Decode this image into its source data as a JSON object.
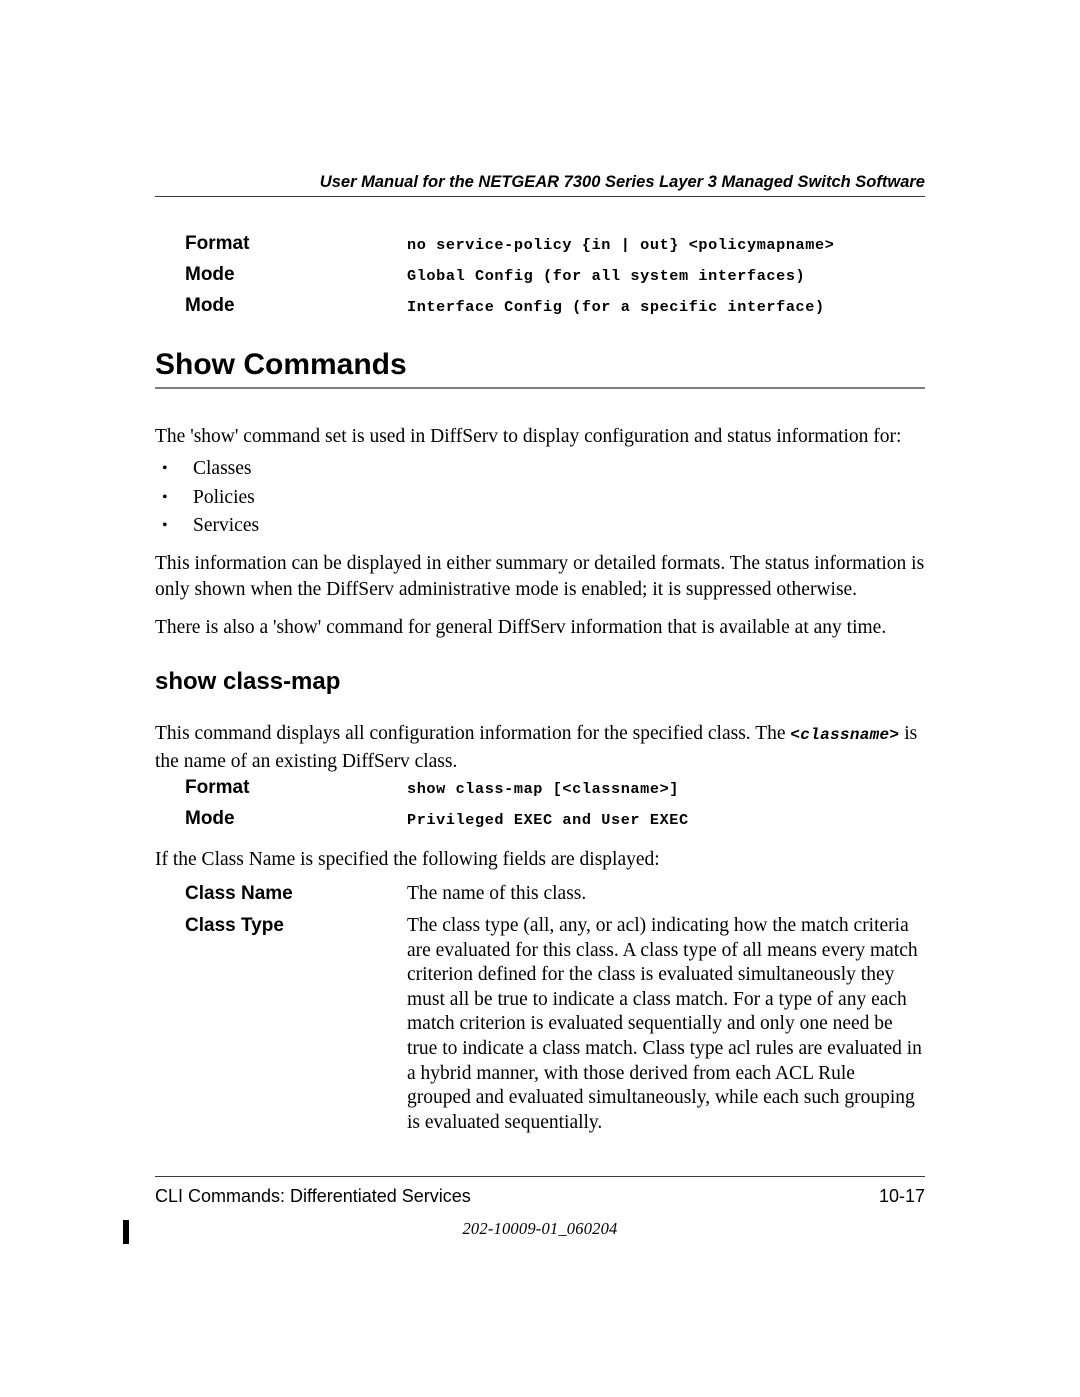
{
  "header": {
    "title": "User Manual for the NETGEAR 7300 Series Layer 3 Managed Switch Software"
  },
  "top_command_block": {
    "rows": [
      {
        "label": "Format",
        "value": "no service-policy {in | out} <policymapname>",
        "style": "mono"
      },
      {
        "label": "Mode",
        "value": "Global Config (for all system interfaces)",
        "style": "mono"
      },
      {
        "label": "Mode",
        "value": "Interface Config (for a specific interface)",
        "style": "mono"
      }
    ]
  },
  "section": {
    "heading": "Show Commands",
    "intro": "The 'show' command set is used in DiffServ to display configuration and status information for:",
    "bullets": [
      {
        "marker": "•",
        "text": "Classes"
      },
      {
        "marker": "•",
        "text": "Policies"
      },
      {
        "marker": "•",
        "text": "Services"
      }
    ],
    "paragraph_2": "This information can be displayed in either summary or detailed formats. The status information is only shown when the DiffServ administrative mode is enabled; it is suppressed otherwise.",
    "paragraph_3": "There is also a 'show' command for general DiffServ information that is available at any time."
  },
  "command": {
    "heading": "show class-map",
    "description_before": "This command displays all configuration information for the specified class. The ",
    "description_code": "<classname>",
    "description_after": " is the name of an existing DiffServ class.",
    "rows": [
      {
        "label": "Format",
        "value": "show class-map [<classname>]",
        "style": "mono"
      },
      {
        "label": "Mode",
        "value": "Privileged EXEC and User EXEC",
        "style": "mono"
      }
    ],
    "fields_intro": "If the Class Name is specified the following fields are displayed:",
    "fields": [
      {
        "label": "Class Name",
        "value": "The name of this class."
      },
      {
        "label": "Class Type",
        "value": "The class type (all, any, or acl) indicating how the match criteria are evaluated for this class. A class type of all means every match criterion defined for the class is evaluated simultaneously they must all be true to indicate a class match. For a type of any each match criterion is evaluated sequentially and only one need be true to indicate a class match. Class type acl rules are evaluated in a hybrid manner, with those derived from each ACL Rule grouped and evaluated simultaneously, while each such grouping is evaluated sequentially."
      }
    ]
  },
  "footer": {
    "chapter": "CLI Commands: Differentiated Services",
    "page_number": "10-17",
    "document_id": "202-10009-01_060204"
  },
  "colors": {
    "text": "#000000",
    "header_rule": "#3a3a3a",
    "section_rule": "#7d7d7d",
    "page_background": "#ffffff"
  }
}
